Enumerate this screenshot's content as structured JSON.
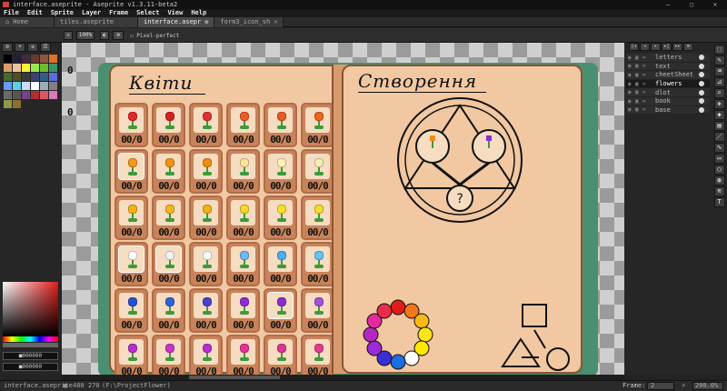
{
  "window": {
    "title": "interface.aseprite - Aseprite v1.3.11-beta2"
  },
  "menu": [
    "File",
    "Edit",
    "Sprite",
    "Layer",
    "Frame",
    "Select",
    "View",
    "Help"
  ],
  "tabs": [
    {
      "label": "Home",
      "active": false
    },
    {
      "label": "tiles.aseprite",
      "active": false
    },
    {
      "label": "interface.asepr",
      "active": true,
      "modified": true
    },
    {
      "label": "form3_icon_sh",
      "active": false
    }
  ],
  "context_bar": {
    "zoom_field": "100%",
    "pixel_perfect_label": "Pixel-perfect"
  },
  "canvas": {
    "left_page_title": "Квіти",
    "right_page_title": "Створення",
    "side_counts": [
      "0",
      "0"
    ],
    "card_counts": "00/0",
    "flower_colors": [
      [
        "#e52929",
        "#d42020",
        "#e23333",
        "#ef5a2a",
        "#ea5b1d",
        "#f0641f"
      ],
      [
        "#f39a1c",
        "#f59314",
        "#f28c12",
        "#fbe29a",
        "#fdf2b6",
        "#f6eeb5"
      ],
      [
        "#f6b31a",
        "#f5b51c",
        "#f0b21a",
        "#f7d82a",
        "#f9e02b",
        "#f3dd26"
      ],
      [
        "#ffffff",
        "#f2f2f2",
        "#fafafa",
        "#6fb8f0",
        "#48aef0",
        "#62c4f0"
      ],
      [
        "#2750d6",
        "#3061d8",
        "#4a40d3",
        "#8e2bd8",
        "#8a2ed0",
        "#a64fd8"
      ],
      [
        "#b62ecb",
        "#cc33c9",
        "#b52fd2",
        "#e53196",
        "#d93595",
        "#e43a8f"
      ]
    ],
    "selected_cards": [
      [
        1,
        0
      ],
      [
        3,
        0
      ],
      [
        3,
        1
      ],
      [
        4,
        4
      ]
    ],
    "color_wheel": [
      "#e41b1b",
      "#f2771a",
      "#f8b914",
      "#f8e51a",
      "#ffe700",
      "#ffffff",
      "#1b6fe0",
      "#3a2fd6",
      "#9b2bd8",
      "#b627c2",
      "#e3299d",
      "#ea2b4b"
    ]
  },
  "layers": [
    {
      "name": "letters",
      "active": false
    },
    {
      "name": "text",
      "active": false
    },
    {
      "name": "cheetSheet",
      "active": false
    },
    {
      "name": "flowers",
      "active": true
    },
    {
      "name": "dlot",
      "active": false
    },
    {
      "name": "book",
      "active": false
    },
    {
      "name": "base",
      "active": false
    }
  ],
  "palette": [
    "#000000",
    "#222034",
    "#45283c",
    "#663931",
    "#8f563b",
    "#df7126",
    "#d9a066",
    "#eec39a",
    "#fbf236",
    "#99e550",
    "#6abe30",
    "#37946e",
    "#4b692f",
    "#524b24",
    "#323c39",
    "#3f3f74",
    "#306082",
    "#5b6ee1",
    "#639bff",
    "#5fcde4",
    "#cbdbfc",
    "#ffffff",
    "#9badb7",
    "#847e87",
    "#696a6a",
    "#595652",
    "#76428a",
    "#ac3232",
    "#d95763",
    "#d77bba",
    "#8f974a",
    "#8a6f30"
  ],
  "color_picker": {
    "fg": "#000000",
    "bg": "#000000"
  },
  "status": {
    "file": "interface.aseprite",
    "size": "480 270",
    "path": "(F:\\ProjectFlower)",
    "frame_label": "Frame:",
    "frame": "2",
    "zoom": "200.0%"
  }
}
